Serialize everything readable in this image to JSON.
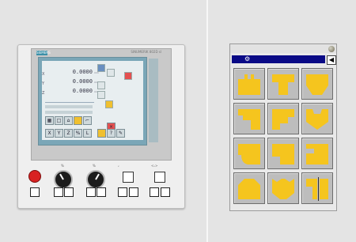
{
  "cnc_panel": {
    "brand": "SIEMENS",
    "model": "SINUMERIK 802D sl",
    "dro_values": [
      "0.0000",
      "0.0000",
      "0.0000"
    ],
    "dro_units": [
      "mm",
      "mm",
      "mm"
    ],
    "axis_softkeys": [
      "X",
      "Y",
      "Z",
      "%",
      "L"
    ],
    "override_labels": [
      "%",
      "%"
    ],
    "spindle_labels": [
      "ᵥ",
      "<ᵥ>"
    ],
    "colors": {
      "estop": "#d82222",
      "screen": "#7aa6b7"
    }
  },
  "shape_dialog": {
    "icons": [
      "gear-icon",
      "arrow-left-icon"
    ],
    "tiles": [
      "shape-rect-notched",
      "shape-t-top",
      "shape-cup",
      "shape-step-left",
      "shape-step-right",
      "shape-v-cup",
      "shape-round-notch",
      "shape-right-angle",
      "shape-right-notch",
      "shape-house",
      "shape-crown",
      "shape-split"
    ],
    "colors": {
      "title_bar": "#0a0a86",
      "shape_fill": "#f5c51e"
    }
  }
}
